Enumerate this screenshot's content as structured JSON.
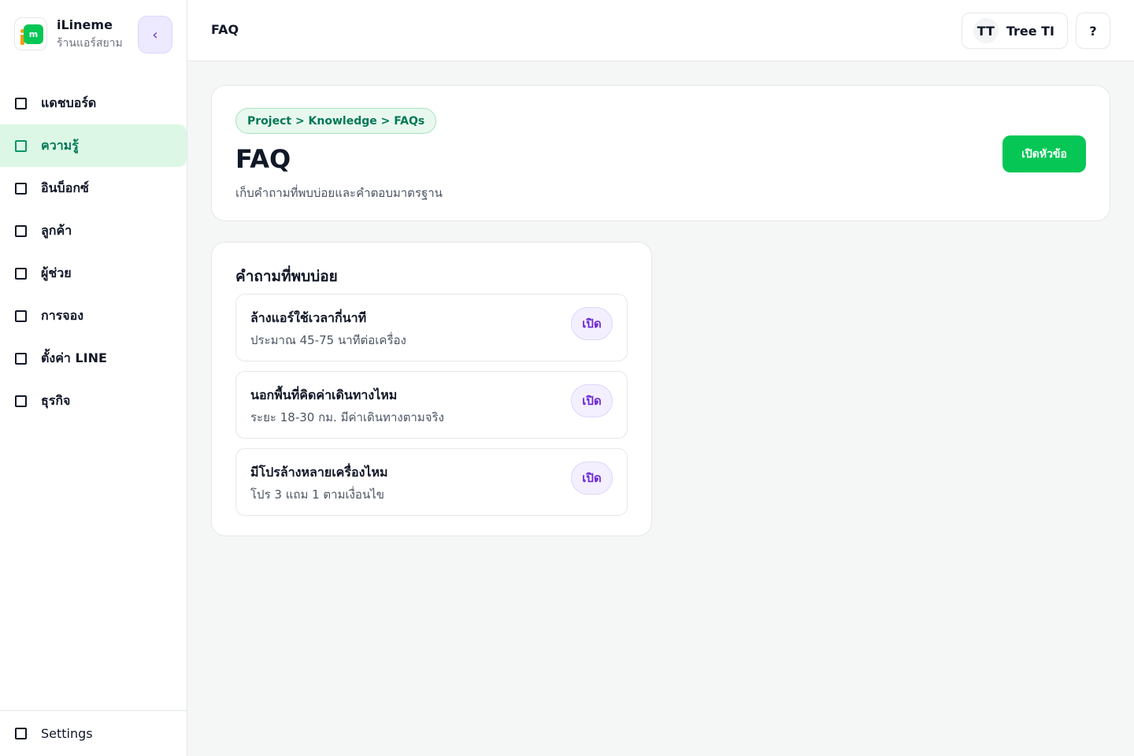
{
  "brand": {
    "name": "iLineme",
    "subtitle": "ร้านแอร์สยาม",
    "logo_letter": "m"
  },
  "sidebar": {
    "collapse_icon": "‹",
    "items": [
      {
        "label": "แดชบอร์ด",
        "active": false
      },
      {
        "label": "ความรู้",
        "active": true
      },
      {
        "label": "อินบ็อกซ์",
        "active": false
      },
      {
        "label": "ลูกค้า",
        "active": false
      },
      {
        "label": "ผู้ช่วย",
        "active": false
      },
      {
        "label": "การจอง",
        "active": false
      },
      {
        "label": "ตั้งค่า LINE",
        "active": false
      },
      {
        "label": "ธุรกิจ",
        "active": false
      }
    ],
    "footer_label": "Settings"
  },
  "topbar": {
    "title": "FAQ",
    "user": {
      "initials": "TT",
      "name": "Tree TI"
    },
    "help_label": "?"
  },
  "header": {
    "breadcrumb": "Project > Knowledge > FAQs",
    "title": "FAQ",
    "description": "เก็บคำถามที่พบบ่อยและคำตอบมาตรฐาน",
    "primary_button": "เปิดหัวข้อ"
  },
  "faq": {
    "heading": "คำถามที่พบบ่อย",
    "items": [
      {
        "question": "ล้างแอร์ใช้เวลากี่นาที",
        "answer": "ประมาณ 45-75 นาทีต่อเครื่อง",
        "button": "เปิด"
      },
      {
        "question": "นอกพื้นที่คิดค่าเดินทางไหม",
        "answer": "ระยะ 18-30 กม. มีค่าเดินทางตามจริง",
        "button": "เปิด"
      },
      {
        "question": "มีโปรล้างหลายเครื่องไหม",
        "answer": "โปร 3 แถม 1 ตามเงื่อนไข",
        "button": "เปิด"
      }
    ]
  },
  "colors": {
    "accent": "#06c755",
    "active_bg": "#dcf7e6",
    "purple": "#6d28d9"
  }
}
